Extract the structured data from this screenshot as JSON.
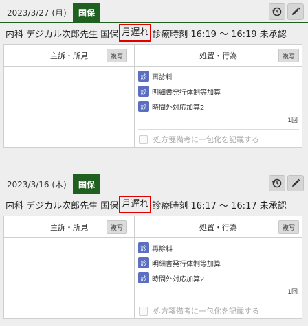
{
  "records": [
    {
      "date": "2023/3/27 (月)",
      "insurance_tag": "国保",
      "info_before": "内科 デジカル次郎先生 国保",
      "info_highlight": "月遅れ",
      "info_after": "診療時刻 16:19 ～ 16:19 未承認",
      "left_header": "主訴・所見",
      "right_header": "処置・行為",
      "copy_label": "複写",
      "items": [
        {
          "badge": "診",
          "label": "再診料"
        },
        {
          "badge": "診",
          "label": "明細書発行体制等加算"
        },
        {
          "badge": "診",
          "label": "時間外対応加算2"
        }
      ],
      "count": "1回",
      "checkbox_label": "処方箋備考に一包化を記載する"
    },
    {
      "date": "2023/3/16 (木)",
      "insurance_tag": "国保",
      "info_before": "内科 デジカル次郎先生 国保",
      "info_highlight": "月遅れ",
      "info_after": "診療時刻 16:17 ～ 16:17 未承認",
      "left_header": "主訴・所見",
      "right_header": "処置・行為",
      "copy_label": "複写",
      "items": [
        {
          "badge": "診",
          "label": "再診料"
        },
        {
          "badge": "診",
          "label": "明細書発行体制等加算"
        },
        {
          "badge": "診",
          "label": "時間外対応加算2"
        }
      ],
      "count": "1回",
      "checkbox_label": "処方箋備考に一包化を記載する"
    }
  ],
  "colors": {
    "tag_green": "#1f5f1f",
    "badge_blue": "#5b6fc2",
    "highlight_red": "#e00000"
  },
  "icons": {
    "history": "history-clock-icon",
    "edit": "pencil-icon"
  }
}
